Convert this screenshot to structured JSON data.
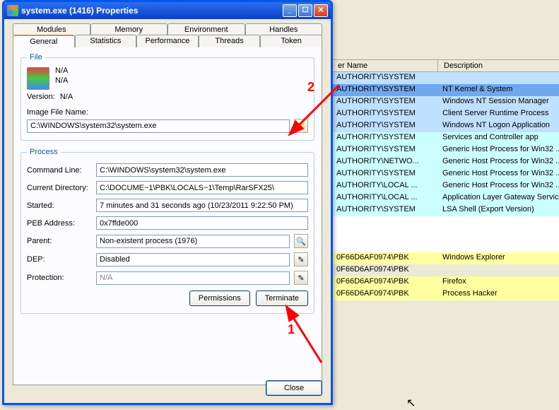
{
  "dialog": {
    "title": "system.exe (1416) Properties",
    "tabs_top": [
      "Modules",
      "Memory",
      "Environment",
      "Handles"
    ],
    "tabs_bottom": [
      "General",
      "Statistics",
      "Performance",
      "Threads",
      "Token"
    ],
    "active_tab": "General",
    "file": {
      "legend": "File",
      "line1": "N/A",
      "line2": "N/A",
      "version_label": "Version:",
      "version": "N/A",
      "image_label": "Image File Name:",
      "image_path": "C:\\WINDOWS\\system32\\system.exe"
    },
    "process": {
      "legend": "Process",
      "cmdline_label": "Command Line:",
      "cmdline": "C:\\WINDOWS\\system32\\system.exe",
      "curdir_label": "Current Directory:",
      "curdir": "C:\\DOCUME~1\\PBK\\LOCALS~1\\Temp\\RarSFX25\\",
      "started_label": "Started:",
      "started": "7 minutes and 31 seconds ago (10/23/2011 9:22:50 PM)",
      "peb_label": "PEB Address:",
      "peb": "0x7ffde000",
      "parent_label": "Parent:",
      "parent": "Non-existent process (1976)",
      "dep_label": "DEP:",
      "dep": "Disabled",
      "protection_label": "Protection:",
      "protection": "N/A",
      "permissions_btn": "Permissions",
      "terminate_btn": "Terminate"
    },
    "close_btn": "Close"
  },
  "background": {
    "columns": {
      "c1": "er Name",
      "c2": "Description"
    },
    "rows": [
      {
        "cls": "bg-blue",
        "user": "AUTHORITY\\SYSTEM",
        "desc": ""
      },
      {
        "cls": "bg-sel",
        "user": "AUTHORITY\\SYSTEM",
        "desc": "NT Kernel & System"
      },
      {
        "cls": "bg-blue",
        "user": "AUTHORITY\\SYSTEM",
        "desc": "Windows NT Session Manager"
      },
      {
        "cls": "bg-blue",
        "user": "AUTHORITY\\SYSTEM",
        "desc": "Client Server Runtime Process"
      },
      {
        "cls": "bg-blue",
        "user": "AUTHORITY\\SYSTEM",
        "desc": "Windows NT Logon Application"
      },
      {
        "cls": "bg-cyan",
        "user": "AUTHORITY\\SYSTEM",
        "desc": "Services and Controller app"
      },
      {
        "cls": "bg-cyan",
        "user": "AUTHORITY\\SYSTEM",
        "desc": "Generic Host Process for Win32 ..."
      },
      {
        "cls": "bg-cyan",
        "user": "AUTHORITY\\NETWO...",
        "desc": "Generic Host Process for Win32 ..."
      },
      {
        "cls": "bg-cyan",
        "user": "AUTHORITY\\SYSTEM",
        "desc": "Generic Host Process for Win32 ..."
      },
      {
        "cls": "bg-cyan",
        "user": "AUTHORITY\\LOCAL ...",
        "desc": "Generic Host Process for Win32 ..."
      },
      {
        "cls": "bg-cyan",
        "user": "AUTHORITY\\LOCAL ...",
        "desc": "Application Layer Gateway Service"
      },
      {
        "cls": "bg-cyan",
        "user": "AUTHORITY\\SYSTEM",
        "desc": "LSA Shell (Export Version)"
      },
      {
        "cls": "bg-plain",
        "user": "",
        "desc": ""
      },
      {
        "cls": "bg-plain",
        "user": "",
        "desc": ""
      },
      {
        "cls": "bg-plain",
        "user": "",
        "desc": ""
      },
      {
        "cls": "bg-yellow",
        "user": "0F66D6AF0974\\PBK",
        "desc": "Windows Explorer"
      },
      {
        "cls": "bg-gray",
        "user": "0F66D6AF0974\\PBK",
        "desc": ""
      },
      {
        "cls": "bg-yellow",
        "user": "0F66D6AF0974\\PBK",
        "desc": "Firefox"
      },
      {
        "cls": "bg-yellow",
        "user": "0F66D6AF0974\\PBK",
        "desc": "Process Hacker"
      }
    ]
  },
  "annotations": {
    "one": "1",
    "two": "2"
  }
}
